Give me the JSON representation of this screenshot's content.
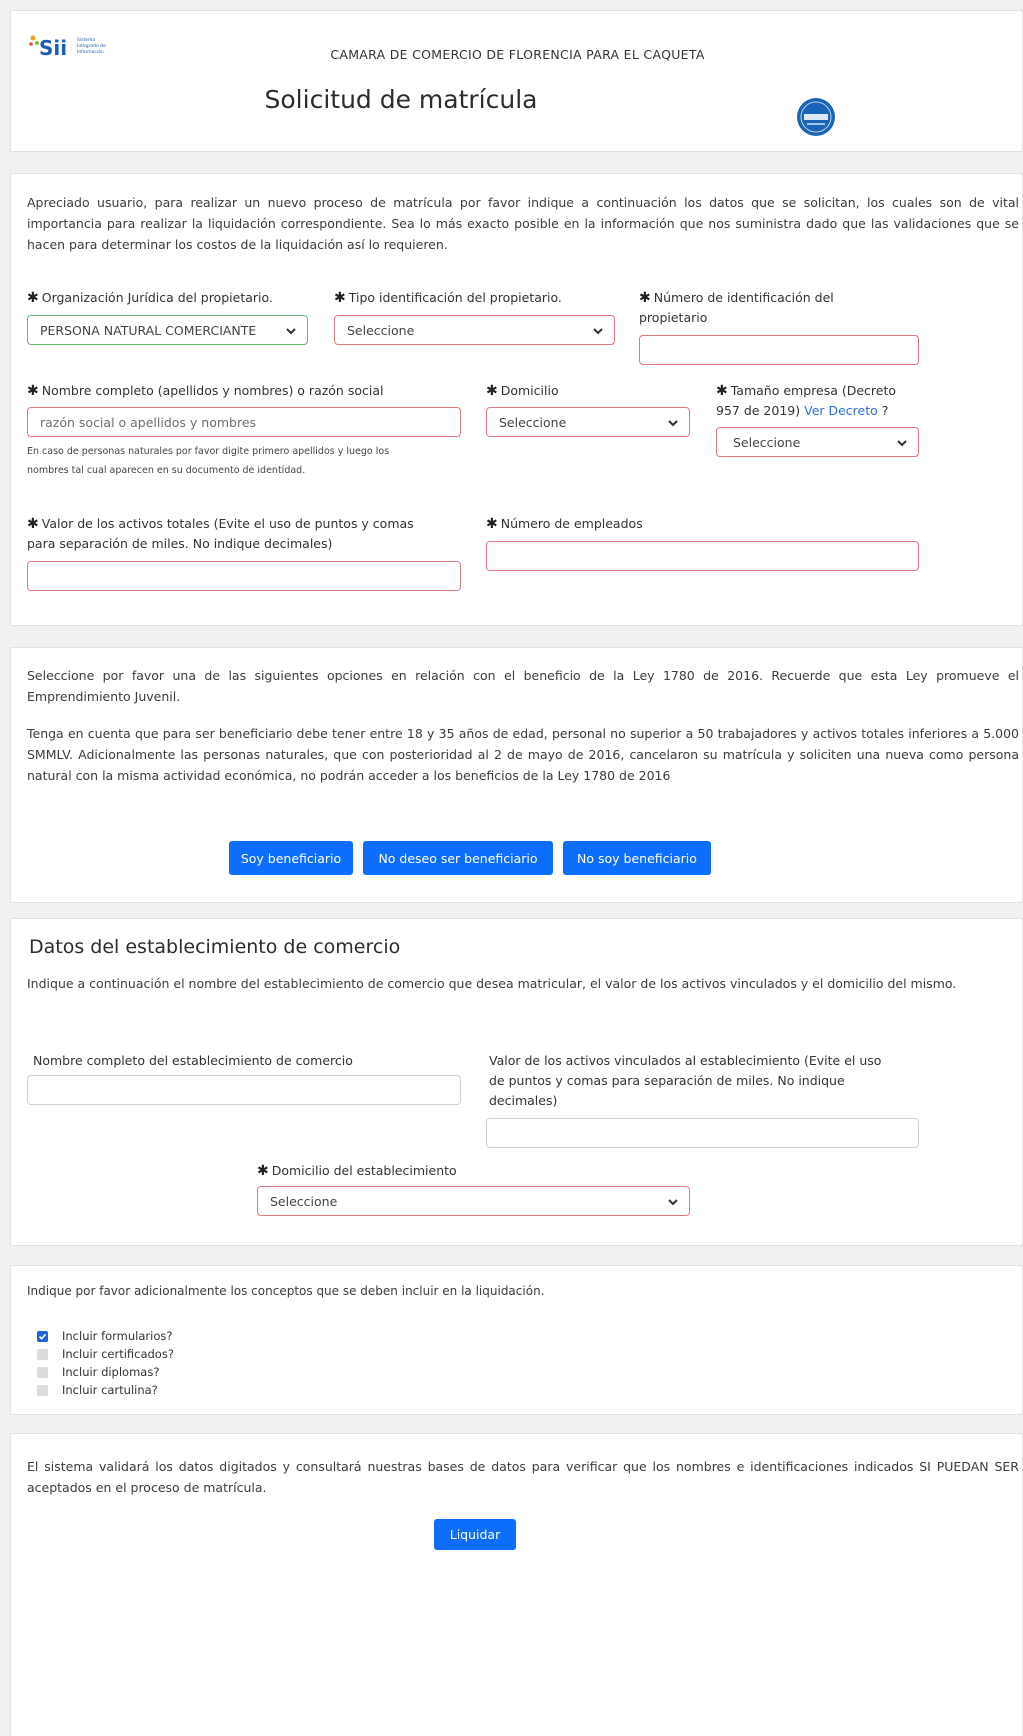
{
  "header": {
    "logo_text": "Sii",
    "logo_sub": "Sistema Integrado de Información",
    "chamber_name": "CAMARA DE COMERCIO DE FLORENCIA PARA EL CAQUETA",
    "page_title": "Solicitud de matrícula"
  },
  "owner_section": {
    "intro": "Apreciado usuario, para realizar un nuevo proceso de matrícula por favor indique a continuación los datos que se solicitan, los cuales son de vital importancia para realizar la liquidación correspondiente. Sea lo más exacto posible en la información que nos suministra dado que las validaciones que se hacen para determinar los costos de la liquidación así lo requieren.",
    "org_label": "Organización Jurídica del propietario.",
    "org_value": "PERSONA NATURAL COMERCIANTE",
    "id_type_label": "Tipo identificación del propietario.",
    "id_type_value": "Seleccione",
    "id_number_label": "Número de identificación del propietario",
    "id_number_value": "",
    "name_label": "Nombre completo (apellidos y nombres) o razón social",
    "name_placeholder": "razón social o apellidos y nombres",
    "name_note_line1": "En caso de personas naturales por favor digite primero apellidos y luego los",
    "name_note_line2": "nombres tal cual aparecen en su documento de identidad.",
    "domicile_label": "Domicilio",
    "domicile_value": "Seleccione",
    "size_label_line1": "Tamaño empresa (Decreto",
    "size_label_line2": "957 de 2019)",
    "size_link": "Ver Decreto",
    "size_help": "?",
    "size_value": "Seleccione",
    "assets_label_line1": "Valor de los activos totales (Evite el uso de puntos y comas",
    "assets_label_line2": "para separación de miles. No indique decimales)",
    "assets_value": "",
    "employees_label": "Número de empleados",
    "employees_value": ""
  },
  "benefit_section": {
    "para1": "Seleccione por favor una de las siguientes opciones en relación con el beneficio de la Ley 1780 de 2016. Recuerde que esta Ley promueve el Emprendimiento Juvenil.",
    "para2": "Tenga en cuenta que para ser beneficiario debe tener entre 18 y 35 años de edad, personal no superior a 50 trabajadores y activos totales inferiores a 5.000 SMMLV. Adicionalmente las personas naturales, que con posterioridad al 2 de mayo de 2016, cancelaron su matrícula y soliciten una nueva como persona natural con la misma actividad económica, no podrán acceder a los beneficios de la Ley 1780 de 2016",
    "btn_yes": "Soy beneficiario",
    "btn_no_wish": "No deseo ser beneficiario",
    "btn_not": "No soy beneficiario"
  },
  "establishment_section": {
    "title": "Datos del establecimiento de comercio",
    "intro": "Indique a continuación el nombre del establecimiento de comercio que desea matricular, el valor de los activos vinculados y el domicilio del mismo.",
    "name_label": "Nombre completo del establecimiento de comercio",
    "name_value": "",
    "assets_label_line1": "Valor de los activos vinculados al establecimiento (Evite el uso",
    "assets_label_line2": "de puntos y comas para separación de miles. No indique",
    "assets_label_line3": "decimales)",
    "assets_value": "",
    "domicile_label": "Domicilio del establecimiento",
    "domicile_value": "Seleccione"
  },
  "concepts_section": {
    "intro": "Indique por favor adicionalmente los conceptos que se deben incluir en la liquidación.",
    "items": [
      {
        "label": "Incluir formularios?",
        "checked": true
      },
      {
        "label": "Incluir certificados?",
        "checked": false
      },
      {
        "label": "Incluir diplomas?",
        "checked": false
      },
      {
        "label": "Incluir cartulina?",
        "checked": false
      }
    ]
  },
  "submit_section": {
    "text": "El sistema validará los datos digitados y consultará nuestras bases de datos para verificar que los nombres e identificaciones indicados SI PUEDAN SER aceptados en el proceso de matrícula.",
    "button": "Liquidar"
  },
  "colors": {
    "accent": "#0d6efd",
    "invalid_border": "#e07a7e",
    "valid_border": "#66b96d"
  }
}
